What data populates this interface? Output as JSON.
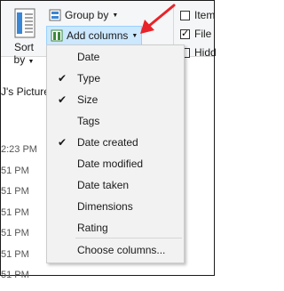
{
  "ribbon": {
    "sort_label": "Sort",
    "sort_by": "by",
    "group_by_label": "Group by",
    "add_columns_label": "Add columns",
    "check_items": [
      {
        "label": "Item",
        "checked": false
      },
      {
        "label": "File",
        "checked": true
      },
      {
        "label": "Hidd",
        "checked": false
      }
    ]
  },
  "content": {
    "path_label": "J's Picture",
    "times": [
      "2:23 PM",
      "51 PM",
      "51 PM",
      "51 PM",
      "51 PM",
      "51 PM",
      "51 PM"
    ]
  },
  "menu": {
    "items": [
      {
        "label": "Date",
        "checked": false
      },
      {
        "label": "Type",
        "checked": true
      },
      {
        "label": "Size",
        "checked": true
      },
      {
        "label": "Tags",
        "checked": false
      },
      {
        "label": "Date created",
        "checked": true
      },
      {
        "label": "Date modified",
        "checked": false
      },
      {
        "label": "Date taken",
        "checked": false
      },
      {
        "label": "Dimensions",
        "checked": false
      },
      {
        "label": "Rating",
        "checked": false
      }
    ],
    "choose_label": "Choose columns..."
  },
  "colors": {
    "accent": "#cce8ff",
    "arrow": "#e8232a"
  }
}
